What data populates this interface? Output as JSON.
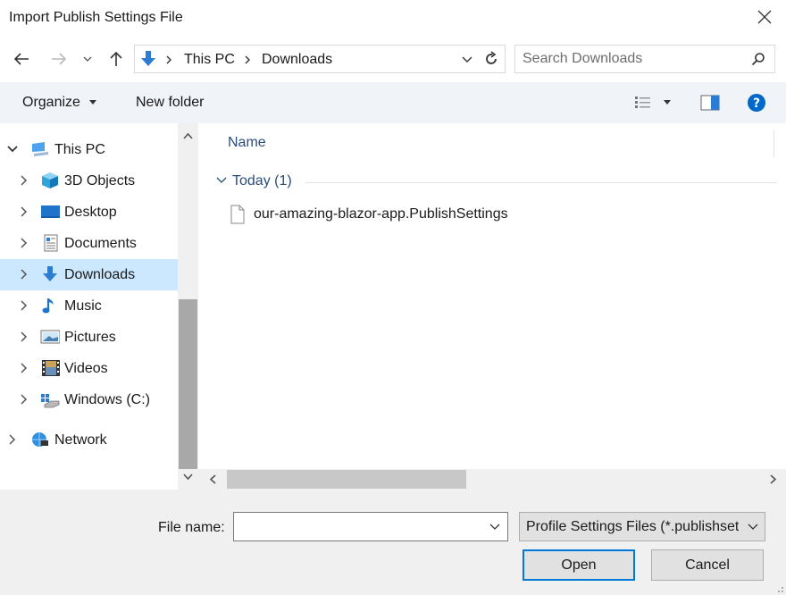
{
  "window": {
    "title": "Import Publish Settings File"
  },
  "address": {
    "crumbs": [
      "This PC",
      "Downloads"
    ]
  },
  "search": {
    "placeholder": "Search Downloads"
  },
  "toolbar": {
    "organize_label": "Organize",
    "new_folder_label": "New folder"
  },
  "nav": {
    "items": [
      {
        "label": "This PC",
        "icon": "pc-icon"
      },
      {
        "label": "3D Objects",
        "icon": "cube-icon"
      },
      {
        "label": "Desktop",
        "icon": "desktop-icon"
      },
      {
        "label": "Documents",
        "icon": "document-icon"
      },
      {
        "label": "Downloads",
        "icon": "download-arrow-icon",
        "selected": true
      },
      {
        "label": "Music",
        "icon": "music-note-icon"
      },
      {
        "label": "Pictures",
        "icon": "pictures-icon"
      },
      {
        "label": "Videos",
        "icon": "film-icon"
      },
      {
        "label": "Windows (C:)",
        "icon": "drive-icon"
      },
      {
        "label": "Network",
        "icon": "network-icon"
      }
    ]
  },
  "files": {
    "column_name": "Name",
    "group_label": "Today (1)",
    "items": [
      {
        "name": "our-amazing-blazor-app.PublishSettings"
      }
    ]
  },
  "footer": {
    "filename_label": "File name:",
    "filename_value": "",
    "filter_value": "Profile Settings Files (*.publishsettings)",
    "open_label": "Open",
    "cancel_label": "Cancel"
  },
  "colors": {
    "accent": "#0078d7",
    "selection": "#cce8ff",
    "toolbar_bg": "#f0f4f9",
    "link_text": "#2a4d7a"
  }
}
